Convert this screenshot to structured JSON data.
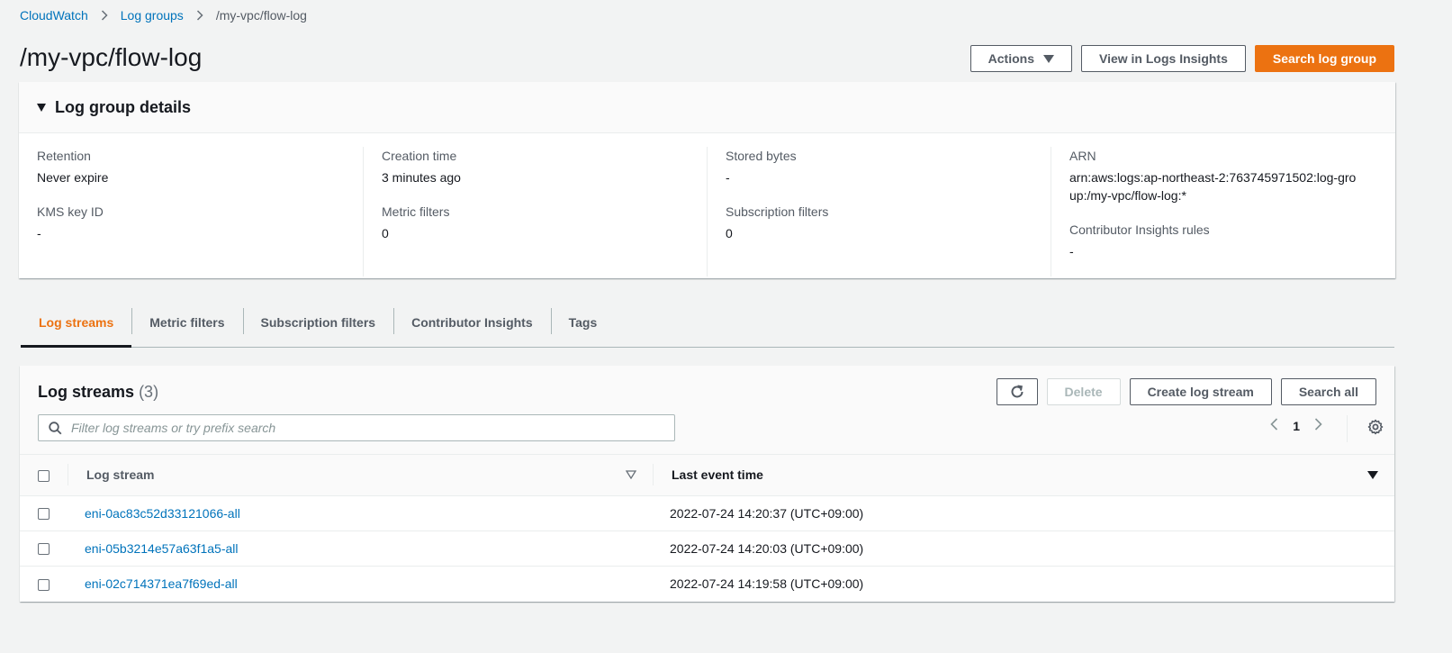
{
  "breadcrumb": {
    "items": [
      "CloudWatch",
      "Log groups"
    ],
    "current": "/my-vpc/flow-log"
  },
  "header": {
    "title": "/my-vpc/flow-log",
    "actions_label": "Actions",
    "view_insights_label": "View in Logs Insights",
    "search_group_label": "Search log group"
  },
  "details": {
    "title": "Log group details",
    "retention_label": "Retention",
    "retention_value": "Never expire",
    "kms_label": "KMS key ID",
    "kms_value": "-",
    "creation_label": "Creation time",
    "creation_value": "3 minutes ago",
    "metric_filters_label": "Metric filters",
    "metric_filters_value": "0",
    "stored_bytes_label": "Stored bytes",
    "stored_bytes_value": "-",
    "subscription_filters_label": "Subscription filters",
    "subscription_filters_value": "0",
    "arn_label": "ARN",
    "arn_value": "arn:aws:logs:ap-northeast-2:763745971502:log-group:/my-vpc/flow-log:*",
    "contributor_label": "Contributor Insights rules",
    "contributor_value": "-"
  },
  "tabs": [
    {
      "label": "Log streams",
      "active": true
    },
    {
      "label": "Metric filters"
    },
    {
      "label": "Subscription filters"
    },
    {
      "label": "Contributor Insights"
    },
    {
      "label": "Tags"
    }
  ],
  "streams": {
    "title": "Log streams",
    "count": "(3)",
    "delete_label": "Delete",
    "create_label": "Create log stream",
    "search_all_label": "Search all",
    "search_placeholder": "Filter log streams or try prefix search",
    "page": "1",
    "col_stream": "Log stream",
    "col_time": "Last event time",
    "rows": [
      {
        "name": "eni-0ac83c52d33121066-all",
        "time": "2022-07-24 14:20:37 (UTC+09:00)"
      },
      {
        "name": "eni-05b3214e57a63f1a5-all",
        "time": "2022-07-24 14:20:03 (UTC+09:00)"
      },
      {
        "name": "eni-02c714371ea7f69ed-all",
        "time": "2022-07-24 14:19:58 (UTC+09:00)"
      }
    ]
  },
  "colors": {
    "link": "#0073bb",
    "primary": "#ec7211",
    "background": "#f2f3f3"
  },
  "icons": [
    "chevron-right-icon",
    "caret-down-icon",
    "refresh-icon",
    "search-icon",
    "chevron-left-icon",
    "settings-gear-icon",
    "sort-icon"
  ]
}
